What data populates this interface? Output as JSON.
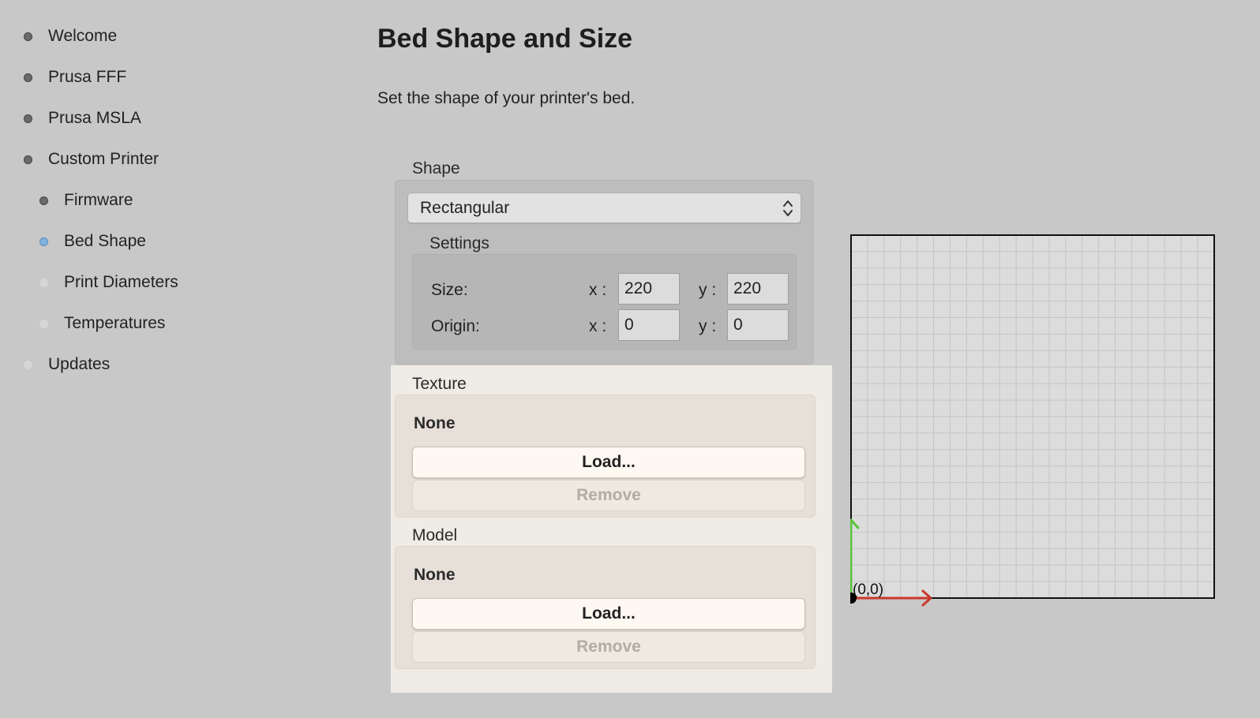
{
  "sidebar": {
    "items": [
      {
        "label": "Welcome",
        "state": "done"
      },
      {
        "label": "Prusa FFF",
        "state": "done"
      },
      {
        "label": "Prusa MSLA",
        "state": "done"
      },
      {
        "label": "Custom Printer",
        "state": "done"
      },
      {
        "label": "Firmware",
        "state": "done"
      },
      {
        "label": "Bed Shape",
        "state": "active"
      },
      {
        "label": "Print Diameters",
        "state": "todo"
      },
      {
        "label": "Temperatures",
        "state": "todo"
      },
      {
        "label": "Updates",
        "state": "todo"
      }
    ]
  },
  "main": {
    "title": "Bed Shape and Size",
    "description": "Set the shape of your printer's bed.",
    "shape": {
      "label": "Shape",
      "selected": "Rectangular"
    },
    "settings": {
      "label": "Settings",
      "size_label": "Size:",
      "origin_label": "Origin:",
      "x_label": "x :",
      "y_label": "y :",
      "size_x": "220",
      "size_y": "220",
      "origin_x": "0",
      "origin_y": "0"
    },
    "texture": {
      "label": "Texture",
      "value": "None",
      "load_label": "Load...",
      "remove_label": "Remove"
    },
    "model": {
      "label": "Model",
      "value": "None",
      "load_label": "Load...",
      "remove_label": "Remove"
    },
    "preview": {
      "origin_label": "(0,0)"
    }
  },
  "colors": {
    "x_axis": "#c8392b",
    "y_axis": "#5cc43c",
    "active_step": "#7fb2dd"
  }
}
